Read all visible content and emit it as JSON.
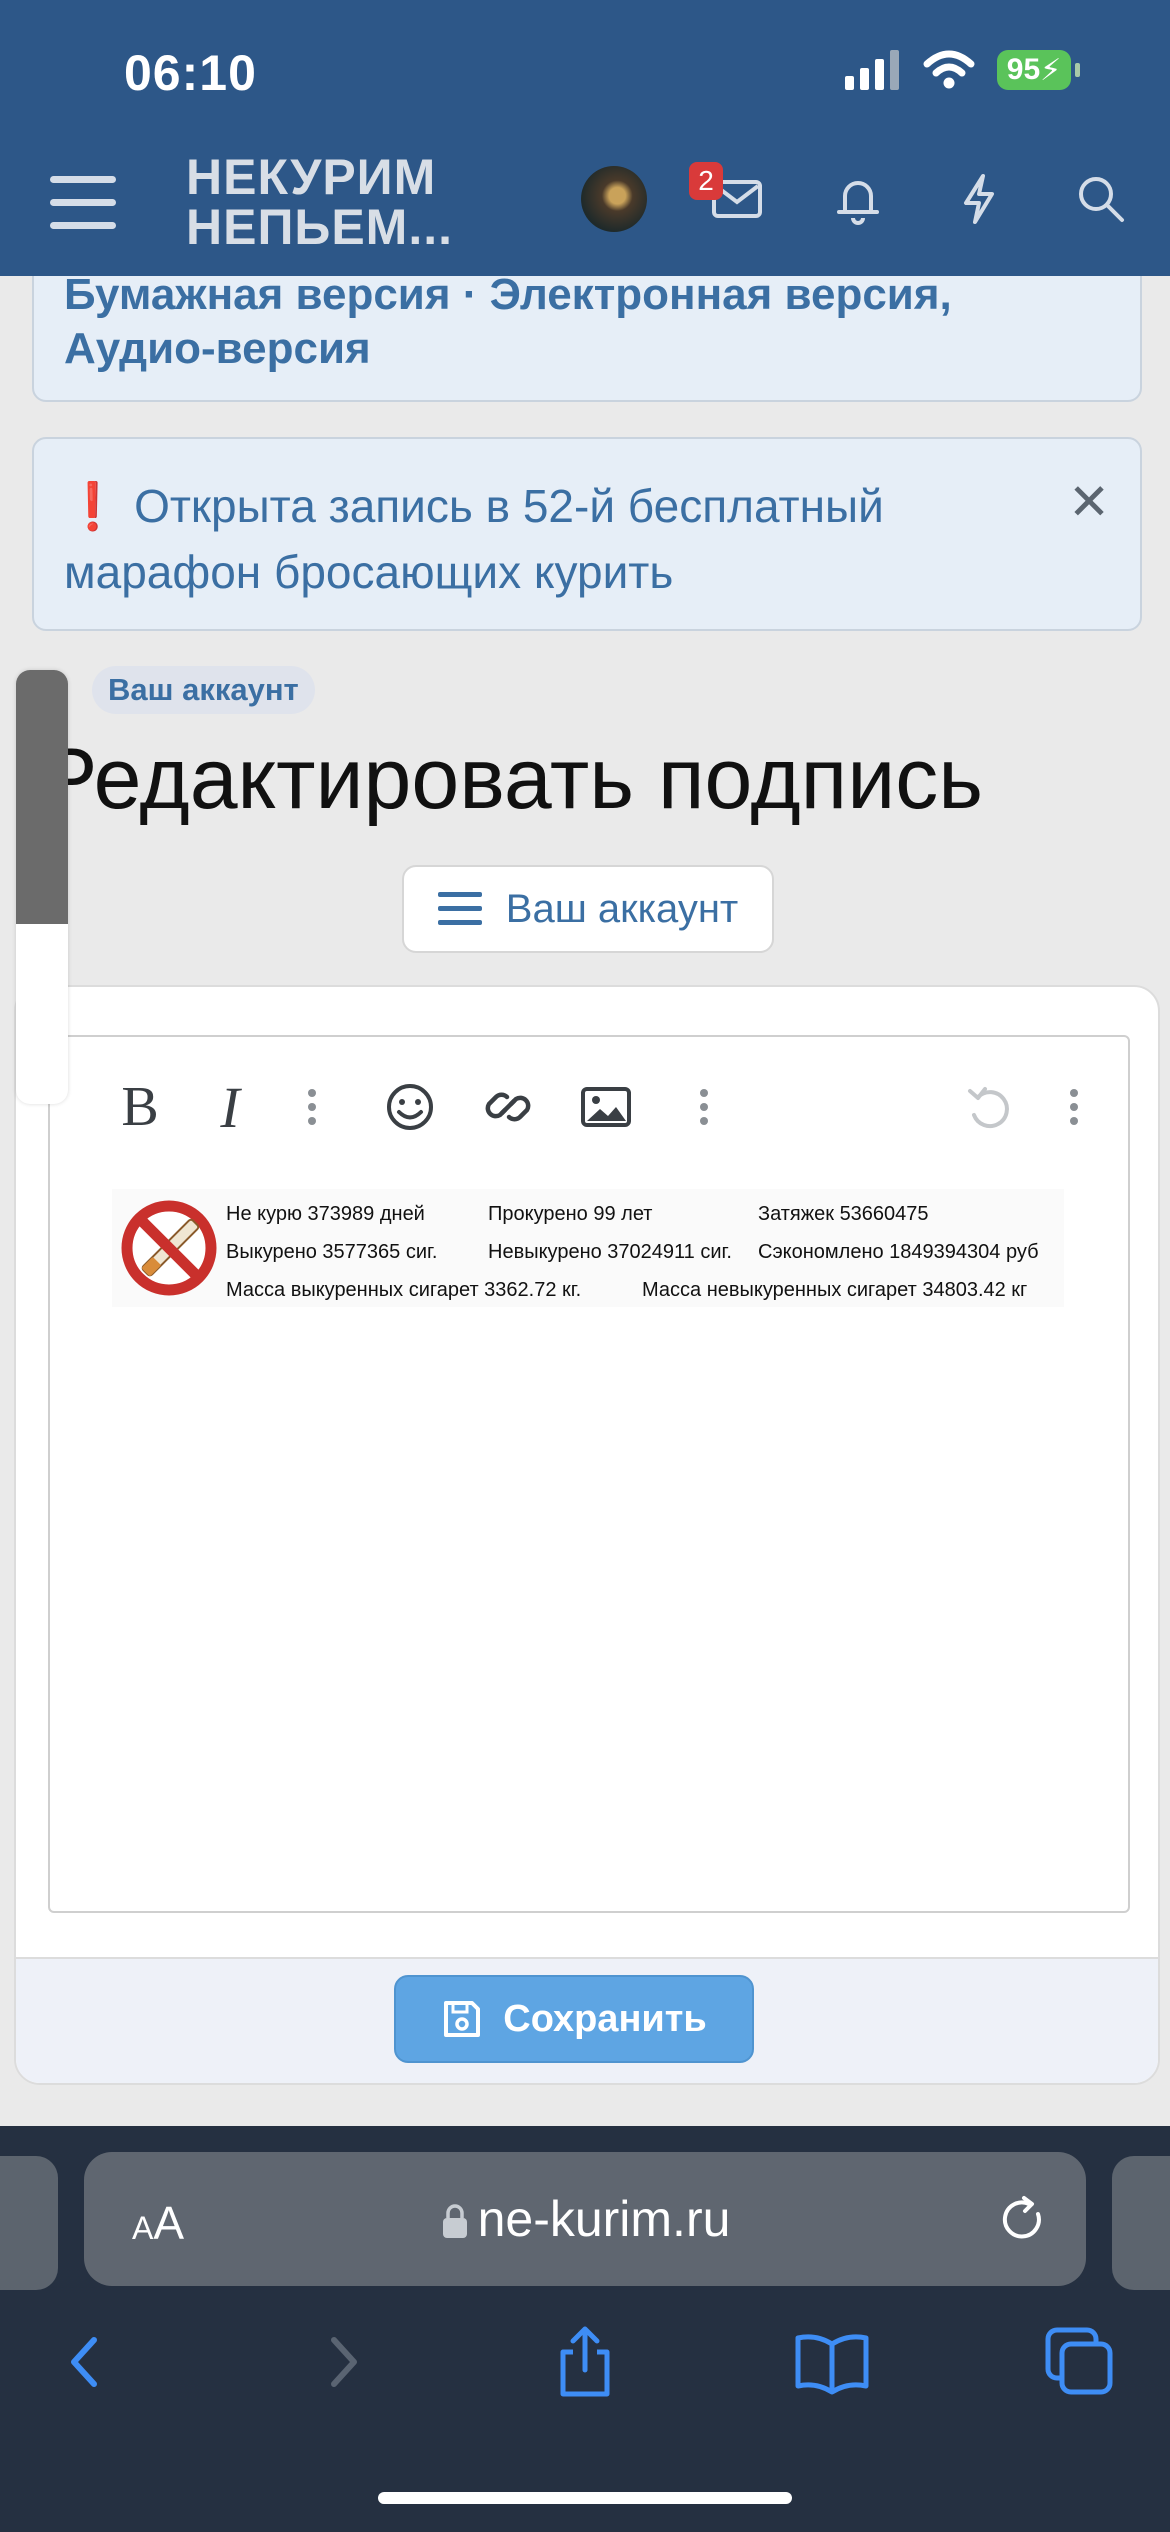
{
  "status_bar": {
    "time": "06:10",
    "battery": "95"
  },
  "header": {
    "logo_line1": "НЕКУРИМ",
    "logo_line2": "НЕПЬЕМ...",
    "mail_badge": "2"
  },
  "notice_top": {
    "clipped_text": "Бумажная версия · Электронная версия,",
    "text": "Аудио-версия"
  },
  "notice_marathon": {
    "icon": "❗",
    "text": "Открыта запись в 52-й бесплатный марафон бросающих курить",
    "close": "✕"
  },
  "breadcrumb": "Ваш аккаунт",
  "page_title": "Редактировать подпись",
  "account_menu_label": "Ваш аккаунт",
  "editor": {
    "toolbar": [
      "bold-icon",
      "italic-icon",
      "more-vertical-icon",
      "smile-icon",
      "link-icon",
      "image-icon",
      "more-vertical-icon",
      "undo-icon",
      "more-vertical-icon"
    ],
    "bold_label": "B",
    "italic_label": "I",
    "signature": {
      "row1": [
        "Не курю 373989 дней",
        "Прокурено 99 лет",
        "Затяжек 53660475"
      ],
      "row2": [
        "Выкурено 3577365 сиг.",
        "Невыкурено 37024911 сиг.",
        "Сэкономлено 1849394304 руб"
      ],
      "row3": [
        "Масса выкуренных сигарет 3362.72 кг.",
        "Масса невыкуренных сигарет 34803.42 кг"
      ]
    }
  },
  "save_label": "Сохранить",
  "safari": {
    "aa_label": "AA",
    "url": "ne-kurim.ru"
  },
  "colors": {
    "header_bg": "#2d5788",
    "link_blue": "#3b6fa3",
    "save_button": "#5ea5e3",
    "safari_bg": "#253041",
    "badge_red": "#d93a3a"
  }
}
